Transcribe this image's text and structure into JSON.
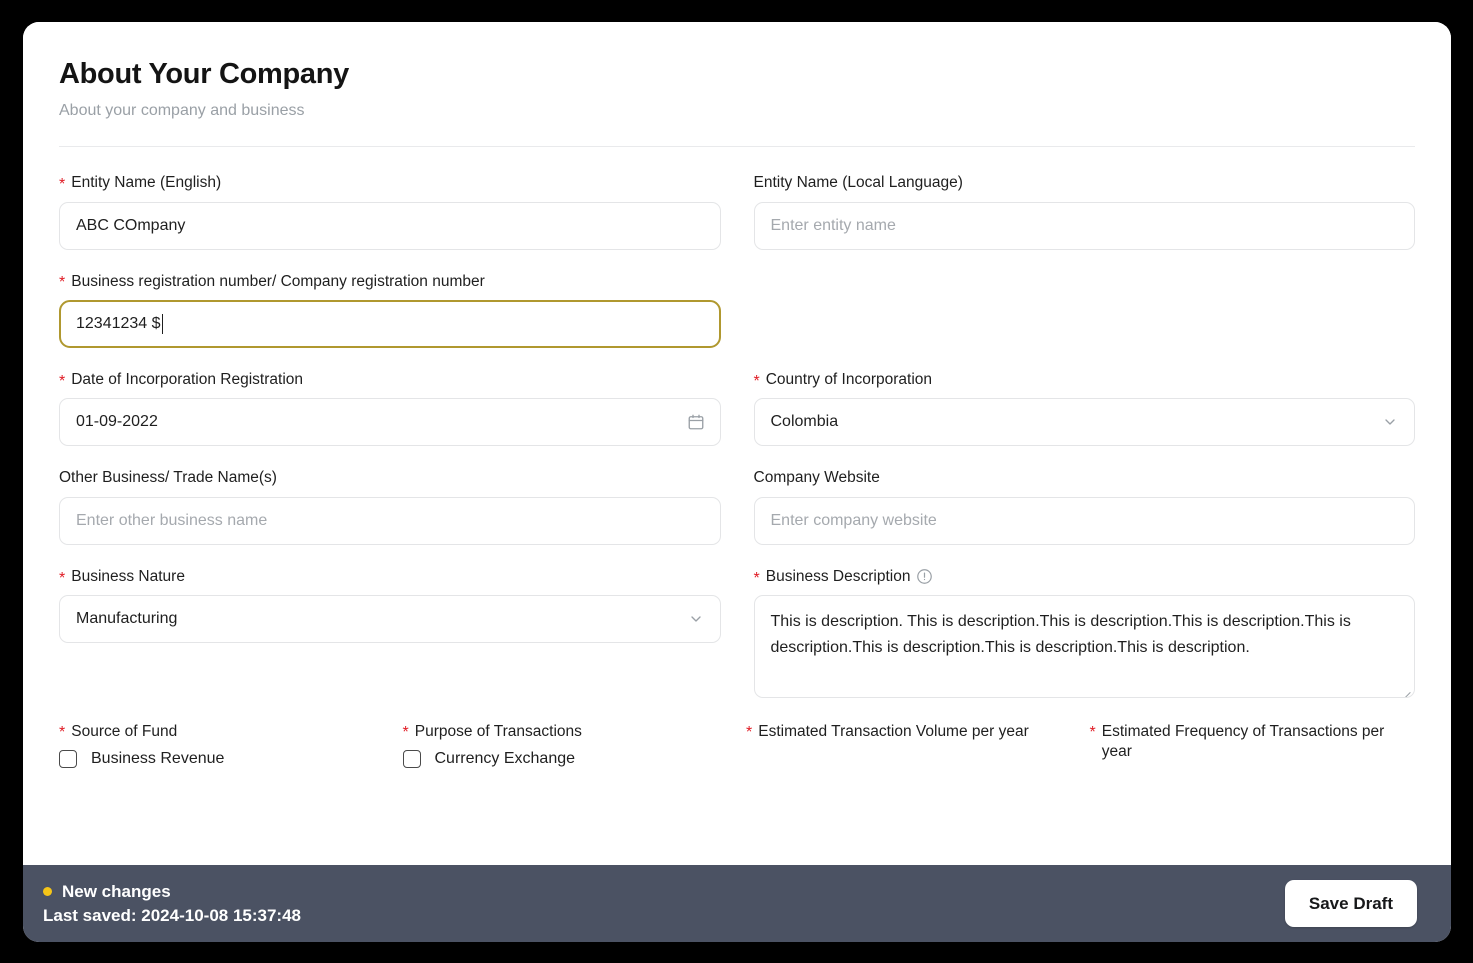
{
  "header": {
    "title": "About Your Company",
    "subtitle": "About your company and business"
  },
  "fields": {
    "entity_name_en": {
      "label": "Entity Name (English)",
      "value": "ABC COmpany",
      "required": true
    },
    "entity_name_local": {
      "label": "Entity Name (Local Language)",
      "placeholder": "Enter entity name",
      "required": false
    },
    "business_registration_number": {
      "label": "Business registration number/ Company registration number",
      "value": "12341234 $",
      "required": true,
      "focused": true
    },
    "date_of_incorporation": {
      "label": "Date of Incorporation Registration",
      "value": "01-09-2022",
      "required": true,
      "icon": "calendar-icon"
    },
    "country_of_incorporation": {
      "label": "Country of Incorporation",
      "value": "Colombia",
      "required": true,
      "icon": "chevron-down-icon"
    },
    "other_business_names": {
      "label": "Other Business/ Trade Name(s)",
      "placeholder": "Enter other business name",
      "required": false
    },
    "company_website": {
      "label": "Company Website",
      "placeholder": "Enter company website",
      "required": false
    },
    "business_nature": {
      "label": "Business Nature",
      "value": "Manufacturing",
      "required": true,
      "icon": "chevron-down-icon"
    },
    "business_description": {
      "label": "Business Description",
      "value": "This is description. This is description.This is description.This is description.This is description.This is description.This is description.This is description.",
      "required": true,
      "icon": "info-icon"
    }
  },
  "checkbox_groups": [
    {
      "label": "Source of Fund",
      "required": true,
      "options": [
        {
          "label": "Business Revenue",
          "checked": false
        }
      ]
    },
    {
      "label": "Purpose of Transactions",
      "required": true,
      "options": [
        {
          "label": "Currency Exchange",
          "checked": false
        }
      ]
    },
    {
      "label": "Estimated Transaction Volume per year",
      "required": true,
      "options": []
    },
    {
      "label": "Estimated Frequency of Transactions per year",
      "required": true,
      "options": []
    }
  ],
  "footer": {
    "status_text": "New changes",
    "last_saved": "Last saved: 2024-10-08 15:37:48",
    "save_draft_label": "Save Draft",
    "status_dot_color": "#f5c518",
    "bar_color": "#4b5263"
  }
}
